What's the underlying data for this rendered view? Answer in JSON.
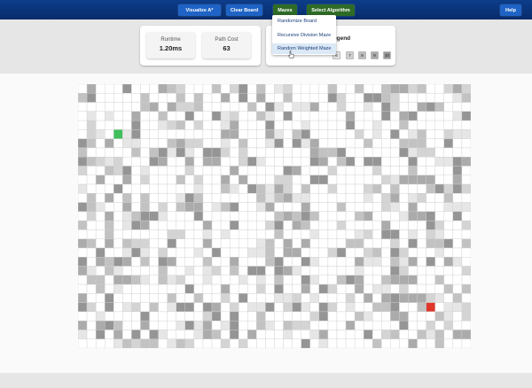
{
  "nav": {
    "visualize": "Visualize A*",
    "clear": "Clear Board",
    "mazes": "Mazes",
    "select_algorithm": "Select Algorithm",
    "help": "Help"
  },
  "stats": {
    "runtime_label": "Runtime",
    "runtime_value": "1.20ms",
    "path_cost_label": "Path Cost",
    "path_cost_value": "63"
  },
  "legend": {
    "title": "egend",
    "weights": [
      "6",
      "7",
      "8",
      "9",
      "10"
    ]
  },
  "mazes_menu": {
    "items": [
      "Randomize Board",
      "Recursive Division Maze",
      "Random Weighted Maze"
    ],
    "hovered": "Random Weighted Maze"
  },
  "grid": {
    "cols": 44,
    "rows": 29,
    "start": {
      "col": 4,
      "row": 5
    },
    "end": {
      "col": 39,
      "row": 24
    },
    "start_color": "#3fbf5a",
    "end_color": "#e0352b"
  },
  "colors": {
    "nav_bg": "#0b3578",
    "btn_blue": "#1e63c5",
    "btn_green": "#2e6b26",
    "weight_min": "#e2e2e2",
    "weight_max": "#8a8a8a"
  }
}
